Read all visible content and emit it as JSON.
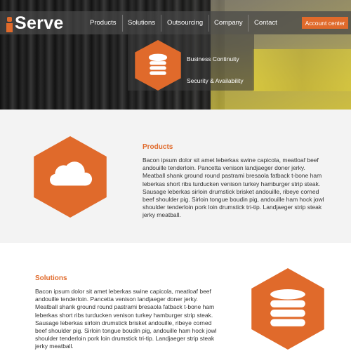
{
  "brand": {
    "name": "Serve"
  },
  "nav": {
    "items": [
      {
        "label": "Products"
      },
      {
        "label": "Solutions"
      },
      {
        "label": "Outsourcing"
      },
      {
        "label": "Company"
      },
      {
        "label": "Contact"
      }
    ],
    "account_button": "Account center"
  },
  "dropdown": {
    "icon": "database-icon",
    "items": [
      {
        "label": "Business Continuity"
      },
      {
        "label": "Security & Availability"
      }
    ]
  },
  "products": {
    "title": "Products",
    "icon": "cloud-icon",
    "body": "Bacon ipsum dolor sit amet leberkas swine capicola, meatloaf beef andouille tenderloin. Pancetta venison landjaeger doner jerky. Meatball shank ground round pastrami bresaola fatback t-bone ham leberkas short ribs turducken venison turkey  hamburger strip steak. Sausage leberkas sirloin drumstick brisket andouille, ribeye corned beef shoulder pig. Sirloin tongue boudin pig, andouille ham hock jowl shoulder tenderloin pork loin drumstick tri-tip. Landjaeger strip steak jerky meatball."
  },
  "solutions": {
    "title": "Solutions",
    "icon": "database-icon",
    "body": "Bacon ipsum dolor sit amet leberkas swine capicola, meatloaf beef andouille tenderloin. Pancetta venison landjaeger doner jerky. Meatball shank ground round pastrami bresaola fatback t-bone ham leberkas short ribs turducken venison turkey  hamburger strip steak. Sausage leberkas sirloin drumstick brisket andouille, ribeye corned beef shoulder pig. Sirloin tongue boudin pig, andouille ham hock jowl shoulder tenderloin pork loin drumstick tri-tip. Landjaeger strip steak jerky meatball."
  },
  "colors": {
    "accent": "#e06a2b",
    "nav_bg": "#464646",
    "text": "#333333",
    "section_bg": "#f3f3f3"
  }
}
